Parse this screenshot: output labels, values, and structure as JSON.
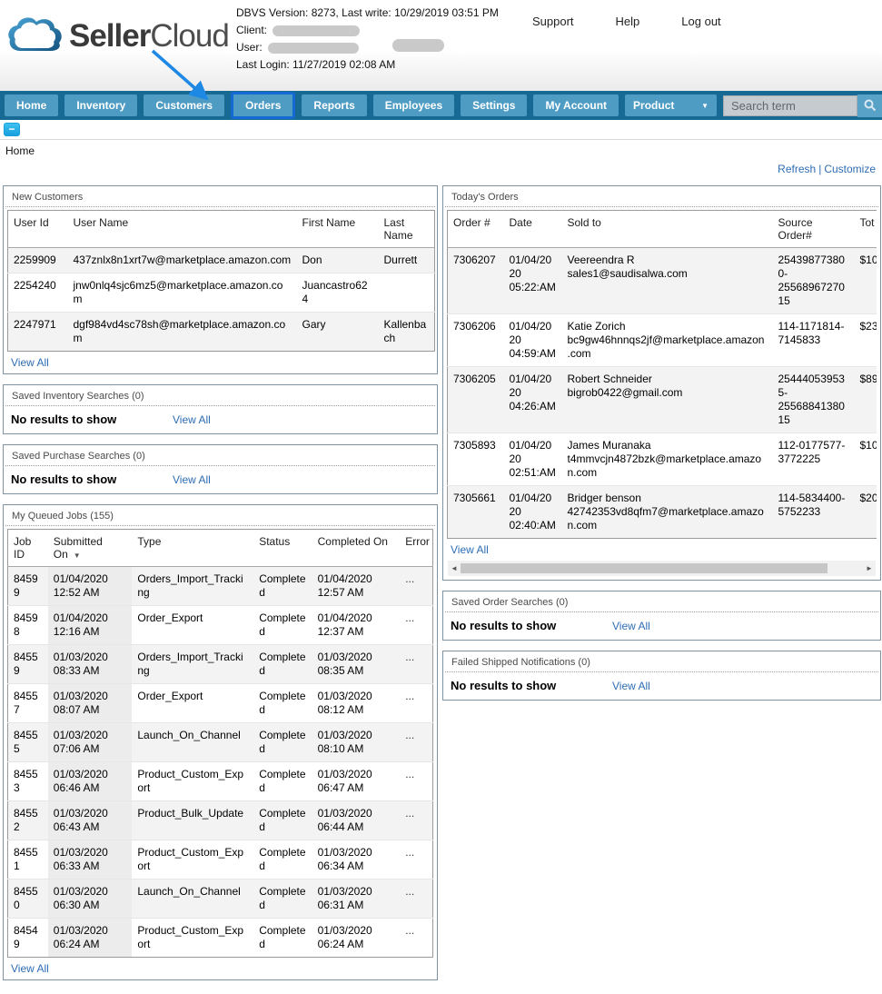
{
  "colors": {
    "navbar": "#176a93",
    "tab_blue": "#4e9cc3",
    "highlight_blue": "#1569d3",
    "link_blue": "#2e6db4",
    "arrow_blue": "#1e88e5",
    "toggle_cyan": "#17a0de"
  },
  "icons": {
    "collapse": "−",
    "dropdown": "▼",
    "sort_desc": "▼",
    "scroll_left": "◄",
    "scroll_right": "►"
  },
  "header": {
    "logo_seller": "Seller",
    "logo_cloud": "Cloud",
    "dbvs_line": "DBVS Version: 8273, Last write: 10/29/2019 03:51 PM",
    "client_label": "Client:",
    "user_label": "User:",
    "last_login_line": "Last Login: 11/27/2019 02:08 AM",
    "links": {
      "support": "Support",
      "help": "Help",
      "logout": "Log out"
    }
  },
  "nav": {
    "tabs": [
      "Home",
      "Inventory",
      "Customers",
      "Orders",
      "Reports",
      "Employees",
      "Settings",
      "My Account"
    ],
    "product_dropdown": "Product",
    "search_placeholder": "Search term"
  },
  "breadcrumb": "Home",
  "actions": {
    "refresh": "Refresh",
    "separator": "|",
    "customize": "Customize"
  },
  "new_customers": {
    "title": "New Customers",
    "headers": [
      "User Id",
      "User Name",
      "First Name",
      "Last Name"
    ],
    "rows": [
      {
        "id": "2259909",
        "user": "437znlx8n1xrt7w@marketplace.amazon.com",
        "first": "Don",
        "last": "Durrett"
      },
      {
        "id": "2254240",
        "user": "jnw0nlq4sjc6mz5@marketplace.amazon.com",
        "first": "Juancastro624",
        "last": ""
      },
      {
        "id": "2247971",
        "user": "dgf984vd4sc78sh@marketplace.amazon.com",
        "first": "Gary",
        "last": "Kallenbach"
      }
    ],
    "view_all": "View All"
  },
  "todays_orders": {
    "title": "Today's Orders",
    "headers": [
      "Order #",
      "Date",
      "Sold to",
      "Source Order#",
      "Tot"
    ],
    "rows": [
      {
        "order": "7306207",
        "date1": "01/04/2020",
        "date2": "05:22:AM",
        "name": "Veereendra R",
        "email": "sales1@saudisalwa.com",
        "src1": "254398773800-",
        "src2": "2556896727015",
        "total": "$10"
      },
      {
        "order": "7306206",
        "date1": "01/04/2020",
        "date2": "04:59:AM",
        "name": "Katie Zorich",
        "email": "bc9gw46hnnqs2jf@marketplace.amazon.com",
        "src1": "114-1171814-",
        "src2": "7145833",
        "total": "$23"
      },
      {
        "order": "7306205",
        "date1": "01/04/2020",
        "date2": "04:26:AM",
        "name": "Robert Schneider",
        "email": "bigrob0422@gmail.com",
        "src1": "254440539535-",
        "src2": "2556884138015",
        "total": "$89"
      },
      {
        "order": "7305893",
        "date1": "01/04/2020",
        "date2": "02:51:AM",
        "name": "James Muranaka",
        "email": "t4mmvcjn4872bzk@marketplace.amazon.com",
        "src1": "112-0177577-",
        "src2": "3772225",
        "total": "$10"
      },
      {
        "order": "7305661",
        "date1": "01/04/2020",
        "date2": "02:40:AM",
        "name": "Bridger benson",
        "email": "42742353vd8qfm7@marketplace.amazon.com",
        "src1": "114-5834400-",
        "src2": "5752233",
        "total": "$20"
      }
    ],
    "view_all": "View All"
  },
  "saved_inventory": {
    "title": "Saved Inventory Searches (0)",
    "empty": "No results to show",
    "view_all": "View All"
  },
  "saved_purchase": {
    "title": "Saved Purchase Searches (0)",
    "empty": "No results to show",
    "view_all": "View All"
  },
  "saved_order": {
    "title": "Saved Order Searches (0)",
    "empty": "No results to show",
    "view_all": "View All"
  },
  "failed_shipped": {
    "title": "Failed Shipped Notifications (0)",
    "empty": "No results to show",
    "view_all": "View All"
  },
  "queued_jobs": {
    "title": "My Queued Jobs (155)",
    "headers": {
      "job": "Job ID",
      "submitted": "Submitted On",
      "type": "Type",
      "status": "Status",
      "completed": "Completed On",
      "error": "Error"
    },
    "rows": [
      {
        "id": "84599",
        "sub1": "01/04/2020",
        "sub2": "12:52 AM",
        "type": "Orders_Import_Tracking",
        "status": "Completed",
        "comp1": "01/04/2020",
        "comp2": "12:57 AM",
        "err": "..."
      },
      {
        "id": "84598",
        "sub1": "01/04/2020",
        "sub2": "12:16 AM",
        "type": "Order_Export",
        "status": "Completed",
        "comp1": "01/04/2020",
        "comp2": "12:37 AM",
        "err": "..."
      },
      {
        "id": "84559",
        "sub1": "01/03/2020",
        "sub2": "08:33 AM",
        "type": "Orders_Import_Tracking",
        "status": "Completed",
        "comp1": "01/03/2020",
        "comp2": "08:35 AM",
        "err": "..."
      },
      {
        "id": "84557",
        "sub1": "01/03/2020",
        "sub2": "08:07 AM",
        "type": "Order_Export",
        "status": "Completed",
        "comp1": "01/03/2020",
        "comp2": "08:12 AM",
        "err": "..."
      },
      {
        "id": "84555",
        "sub1": "01/03/2020",
        "sub2": "07:06 AM",
        "type": "Launch_On_Channel",
        "status": "Completed",
        "comp1": "01/03/2020",
        "comp2": "08:10 AM",
        "err": "..."
      },
      {
        "id": "84553",
        "sub1": "01/03/2020",
        "sub2": "06:46 AM",
        "type": "Product_Custom_Export",
        "status": "Completed",
        "comp1": "01/03/2020",
        "comp2": "06:47 AM",
        "err": "..."
      },
      {
        "id": "84552",
        "sub1": "01/03/2020",
        "sub2": "06:43 AM",
        "type": "Product_Bulk_Update",
        "status": "Completed",
        "comp1": "01/03/2020",
        "comp2": "06:44 AM",
        "err": "..."
      },
      {
        "id": "84551",
        "sub1": "01/03/2020",
        "sub2": "06:33 AM",
        "type": "Product_Custom_Export",
        "status": "Completed",
        "comp1": "01/03/2020",
        "comp2": "06:34 AM",
        "err": "..."
      },
      {
        "id": "84550",
        "sub1": "01/03/2020",
        "sub2": "06:30 AM",
        "type": "Launch_On_Channel",
        "status": "Completed",
        "comp1": "01/03/2020",
        "comp2": "06:31 AM",
        "err": "..."
      },
      {
        "id": "84549",
        "sub1": "01/03/2020",
        "sub2": "06:24 AM",
        "type": "Product_Custom_Export",
        "status": "Completed",
        "comp1": "01/03/2020",
        "comp2": "06:24 AM",
        "err": "..."
      }
    ],
    "view_all": "View All"
  }
}
